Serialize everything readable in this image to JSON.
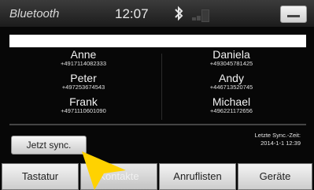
{
  "header": {
    "title": "Bluetooth",
    "time": "12:07"
  },
  "contacts": [
    {
      "name": "Anne",
      "number": "+4917114082333"
    },
    {
      "name": "Daniela",
      "number": "+493045781425"
    },
    {
      "name": "Peter",
      "number": "+497253674543"
    },
    {
      "name": "Andy",
      "number": "+446713520745"
    },
    {
      "name": "Frank",
      "number": "+4971110601090"
    },
    {
      "name": "Michael",
      "number": "+496221172656"
    }
  ],
  "sync": {
    "button_label": "Jetzt sync.",
    "last_sync_label": "Letzte Sync.-Zeit:",
    "last_sync_time": "2014-1-1 12:39"
  },
  "tabs": [
    {
      "label": "Tastatur"
    },
    {
      "label": "Kontakte"
    },
    {
      "label": "Anruflisten"
    },
    {
      "label": "Geräte"
    }
  ],
  "icons": {
    "bluetooth": "bluetooth-icon",
    "minimize": "minimize-icon",
    "pointer": "pointer-cursor"
  }
}
